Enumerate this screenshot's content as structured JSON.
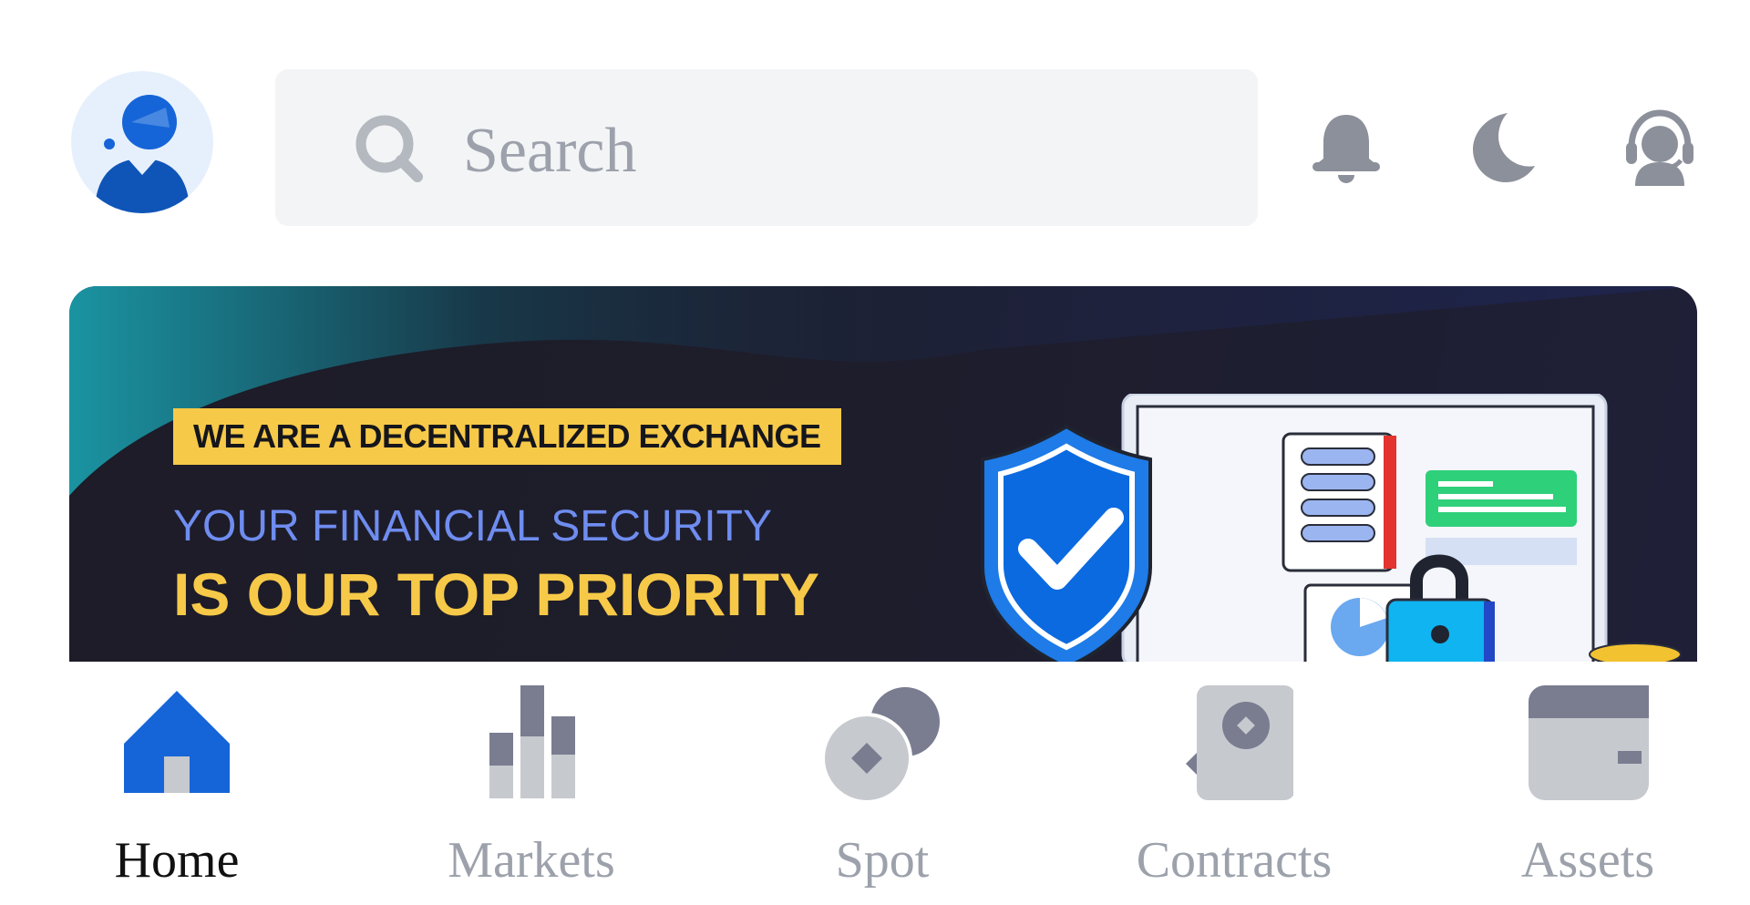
{
  "header": {
    "avatar_icon": "user-avatar-icon",
    "search": {
      "placeholder": "Search",
      "icon": "search-icon"
    },
    "icons": [
      "bell-icon",
      "moon-icon",
      "support-headset-icon"
    ]
  },
  "banner": {
    "tag": "WE ARE A DECENTRALIZED EXCHANGE",
    "line1": "YOUR FINANCIAL SECURITY",
    "line2": "IS OUR TOP PRIORITY",
    "art_icon": "security-shield-illustration"
  },
  "bottom_nav": {
    "active": "Home",
    "items": [
      {
        "label": "Home",
        "icon": "home-icon"
      },
      {
        "label": "Markets",
        "icon": "markets-chart-icon"
      },
      {
        "label": "Spot",
        "icon": "spot-coins-icon"
      },
      {
        "label": "Contracts",
        "icon": "contracts-icon"
      },
      {
        "label": "Assets",
        "icon": "wallet-icon"
      }
    ]
  },
  "colors": {
    "accent": "#1565d8",
    "banner_yellow": "#f7c948",
    "banner_blue_text": "#6f8df0",
    "muted_icon": "#8c909a",
    "inactive_label": "#9ca1ab"
  }
}
